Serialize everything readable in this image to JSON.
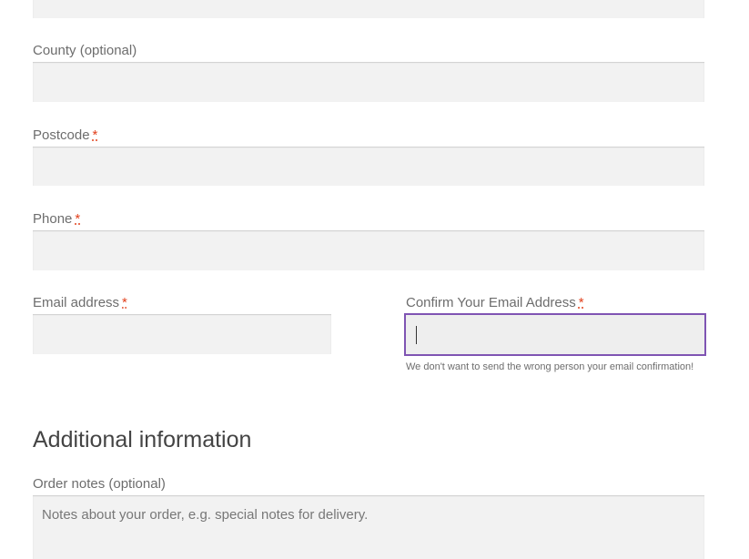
{
  "fields": {
    "county": {
      "label": "County (optional)"
    },
    "postcode": {
      "label": "Postcode",
      "required_mark": "*"
    },
    "phone": {
      "label": "Phone",
      "required_mark": "*"
    },
    "email": {
      "label": "Email address",
      "required_mark": "*"
    },
    "confirm_email": {
      "label": "Confirm Your Email Address",
      "required_mark": "*",
      "help": "We don't want to send the wrong person your email confirmation!"
    }
  },
  "additional": {
    "heading": "Additional information",
    "order_notes_label": "Order notes (optional)",
    "order_notes_placeholder": "Notes about your order, e.g. special notes for delivery."
  },
  "colors": {
    "focus_border": "#7f54b3",
    "required": "#e2401c",
    "input_bg": "#f2f2f2"
  }
}
